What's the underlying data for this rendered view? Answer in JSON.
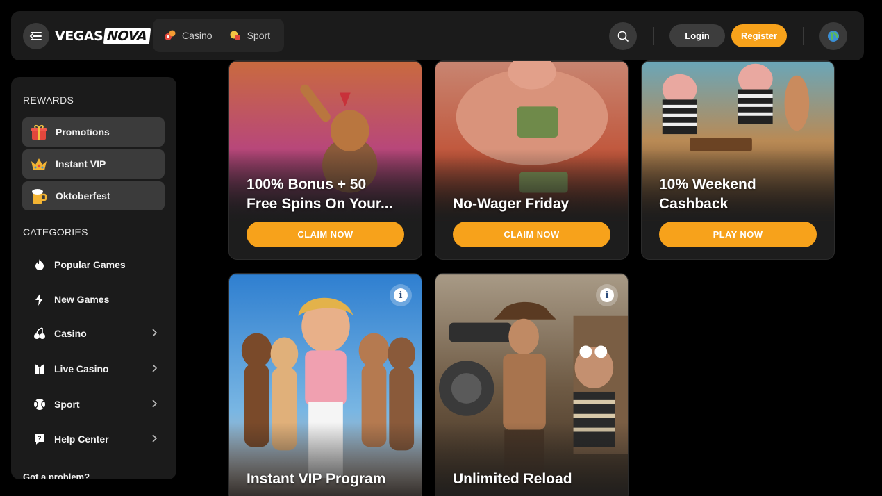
{
  "header": {
    "logo_part1": "VEGAS",
    "logo_part2": "NOVA",
    "nav": [
      {
        "label": "Casino",
        "icon": "casino-chips-icon"
      },
      {
        "label": "Sport",
        "icon": "sport-ball-icon"
      }
    ],
    "login_label": "Login",
    "register_label": "Register"
  },
  "sidebar": {
    "rewards_title": "REWARDS",
    "rewards": [
      {
        "label": "Promotions",
        "icon": "gift-icon"
      },
      {
        "label": "Instant VIP",
        "icon": "crown-icon"
      },
      {
        "label": "Oktoberfest",
        "icon": "beer-icon"
      }
    ],
    "categories_title": "CATEGORIES",
    "categories": [
      {
        "label": "Popular Games",
        "icon": "fire-icon",
        "has_chevron": false
      },
      {
        "label": "New Games",
        "icon": "lightning-icon",
        "has_chevron": false
      },
      {
        "label": "Casino",
        "icon": "cherries-icon",
        "has_chevron": true
      },
      {
        "label": "Live Casino",
        "icon": "dealer-icon",
        "has_chevron": true
      },
      {
        "label": "Sport",
        "icon": "ball-icon",
        "has_chevron": true
      },
      {
        "label": "Help Center",
        "icon": "help-chat-icon",
        "has_chevron": true
      }
    ],
    "problem_text": "Got a problem?"
  },
  "promos": [
    {
      "title_line1": "100% Bonus + 50",
      "title_line2": "Free Spins On Your...",
      "button": "CLAIM NOW"
    },
    {
      "title_line1": "",
      "title_line2": "No-Wager Friday",
      "button": "CLAIM NOW"
    },
    {
      "title_line1": "10% Weekend",
      "title_line2": "Cashback",
      "button": "PLAY NOW"
    },
    {
      "title_line1": "Instant VIP Program",
      "title_line2": "",
      "button": ""
    },
    {
      "title_line1": "Unlimited Reload",
      "title_line2": "",
      "button": ""
    }
  ],
  "colors": {
    "accent": "#f7a21b",
    "panel": "#1b1b1b",
    "page_bg": "#000000"
  }
}
